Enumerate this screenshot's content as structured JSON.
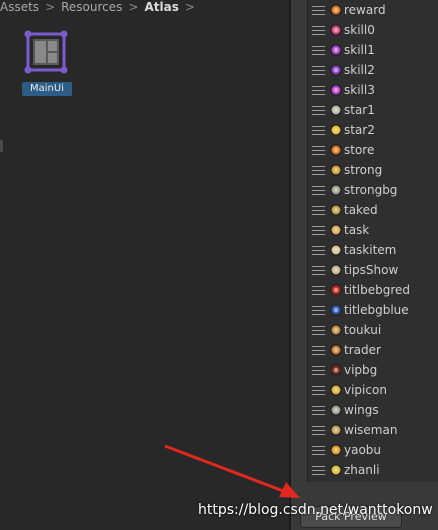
{
  "breadcrumb": {
    "items": [
      "Assets",
      "Resources",
      "Atlas"
    ],
    "separator": ">"
  },
  "asset": {
    "label": "MainUi",
    "icon": "sprite-atlas-icon"
  },
  "atlas_list": {
    "items": [
      {
        "label": "reward",
        "icon": "reward-icon",
        "color": "#e07b2a"
      },
      {
        "label": "skill0",
        "icon": "skill-icon",
        "color": "#d94a8a"
      },
      {
        "label": "skill1",
        "icon": "skill-icon",
        "color": "#b04ad9"
      },
      {
        "label": "skill2",
        "icon": "skill-icon",
        "color": "#8a4ad9"
      },
      {
        "label": "skill3",
        "icon": "skill-icon",
        "color": "#c04ad9"
      },
      {
        "label": "star1",
        "icon": "star-icon",
        "color": "#b8b8b8"
      },
      {
        "label": "star2",
        "icon": "star-icon",
        "color": "#e6c23a"
      },
      {
        "label": "store",
        "icon": "store-icon",
        "color": "#e07b2a"
      },
      {
        "label": "strong",
        "icon": "strong-icon",
        "color": "#d8a040"
      },
      {
        "label": "strongbg",
        "icon": "ring-icon",
        "color": "#a0a0a0"
      },
      {
        "label": "taked",
        "icon": "taked-icon",
        "color": "#c8a050"
      },
      {
        "label": "task",
        "icon": "task-icon",
        "color": "#e0b060"
      },
      {
        "label": "taskitem",
        "icon": "taskitem-icon",
        "color": "#d8c8a0"
      },
      {
        "label": "tipsShow",
        "icon": "tips-icon",
        "color": "#c8b890"
      },
      {
        "label": "titlbebgred",
        "icon": "banner-icon",
        "color": "#c83030"
      },
      {
        "label": "titlebgblue",
        "icon": "banner-icon",
        "color": "#3060c8"
      },
      {
        "label": "toukui",
        "icon": "helmet-icon",
        "color": "#c89050"
      },
      {
        "label": "trader",
        "icon": "trader-icon",
        "color": "#d08040"
      },
      {
        "label": "vipbg",
        "icon": "vip-bg-icon",
        "color": "#8a3020"
      },
      {
        "label": "vipicon",
        "icon": "vip-icon",
        "color": "#e0b040"
      },
      {
        "label": "wings",
        "icon": "wings-icon",
        "color": "#a0a0a0"
      },
      {
        "label": "wiseman",
        "icon": "wiseman-icon",
        "color": "#c8a060"
      },
      {
        "label": "yaobu",
        "icon": "yaobu-icon",
        "color": "#e0a030"
      },
      {
        "label": "zhanli",
        "icon": "zhanli-icon",
        "color": "#e0c040"
      }
    ]
  },
  "pack_preview": {
    "label": "Pack Preview"
  },
  "watermark": {
    "text": "https://blog.csdn.net/wanttokonw"
  },
  "colors": {
    "annotation_arrow": "#e0281e",
    "selection": "#2c5d87",
    "atlas_icon": "#7b5ccf"
  }
}
